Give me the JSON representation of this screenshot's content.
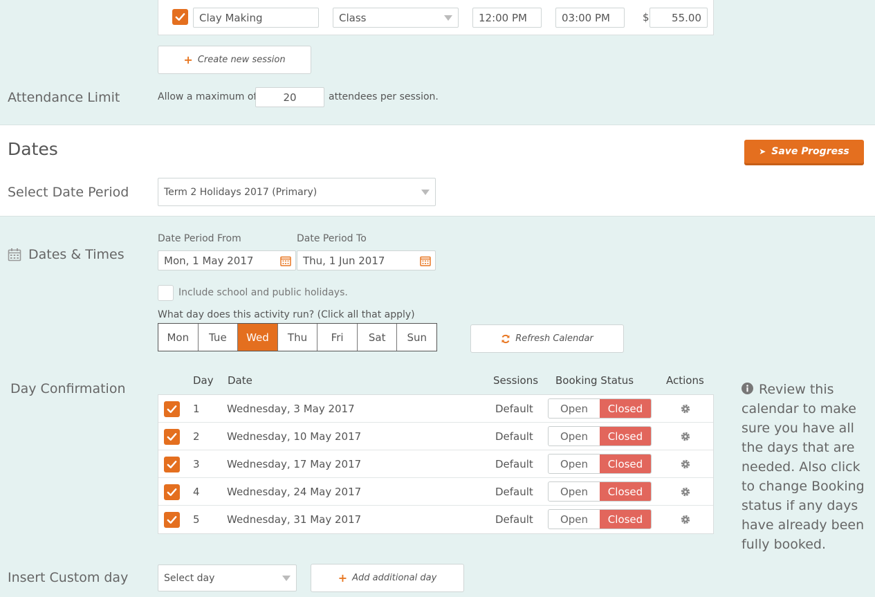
{
  "session": {
    "name": "Clay Making",
    "type": "Class",
    "start_time": "12:00 PM",
    "end_time": "03:00 PM",
    "currency": "$",
    "price": "55.00",
    "create_label": "Create new session"
  },
  "attendance": {
    "label": "Attendance Limit",
    "prefix": "Allow a maximum of",
    "value": "20",
    "suffix": "attendees per session."
  },
  "dates": {
    "heading": "Dates",
    "save_label": "Save Progress",
    "period_label": "Select Date Period",
    "period_value": "Term 2 Holidays 2017 (Primary)"
  },
  "dates_times": {
    "label": "Dates & Times",
    "from_label": "Date Period From",
    "from_value": "Mon, 1 May 2017",
    "to_label": "Date Period To",
    "to_value": "Thu, 1 Jun 2017",
    "holidays_label": "Include school and public holidays.",
    "days_question": "What day does this activity run? (Click all that apply)",
    "days": [
      "Mon",
      "Tue",
      "Wed",
      "Thu",
      "Fri",
      "Sat",
      "Sun"
    ],
    "active_day": "Wed",
    "refresh_label": "Refresh Calendar"
  },
  "day_confirmation": {
    "label": "Day Confirmation",
    "columns": {
      "day": "Day",
      "date": "Date",
      "sessions": "Sessions",
      "booking_status": "Booking Status",
      "actions": "Actions"
    },
    "open_label": "Open",
    "closed_label": "Closed",
    "rows": [
      {
        "day": "1",
        "date": "Wednesday, 3 May 2017",
        "sessions": "Default"
      },
      {
        "day": "2",
        "date": "Wednesday, 10 May 2017",
        "sessions": "Default"
      },
      {
        "day": "3",
        "date": "Wednesday, 17 May 2017",
        "sessions": "Default"
      },
      {
        "day": "4",
        "date": "Wednesday, 24 May 2017",
        "sessions": "Default"
      },
      {
        "day": "5",
        "date": "Wednesday, 31 May 2017",
        "sessions": "Default"
      }
    ],
    "info": "Review this calendar to make sure you have all the days that are needed. Also click to change Booking status if any days have already been fully booked."
  },
  "custom_day": {
    "label": "Insert Custom day",
    "select_value": "Select day",
    "add_label": "Add additional day"
  },
  "colors": {
    "accent": "#e46f1f",
    "closed": "#e2665c",
    "teal_bg": "#e5f2f1"
  }
}
